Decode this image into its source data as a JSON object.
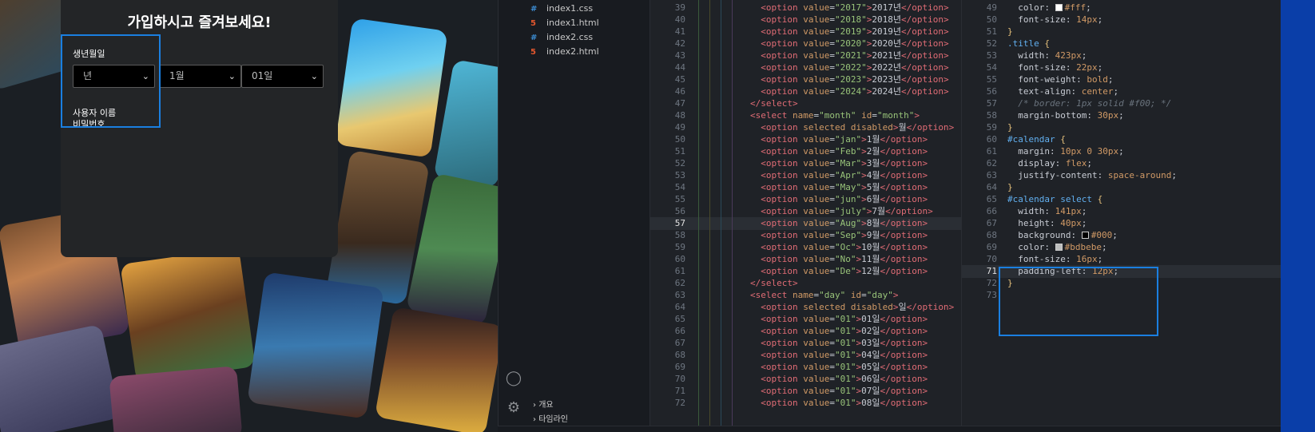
{
  "preview": {
    "title": "가입하시고 즐겨보세요!",
    "birth_label": "생년월일",
    "year_select": "년",
    "month_select": "1월",
    "day_select": "01일",
    "username_label": "사용자 이름",
    "password_label": "비밀번호"
  },
  "explorer": {
    "files": [
      {
        "name": "index1.css",
        "type": "css"
      },
      {
        "name": "index1.html",
        "type": "html"
      },
      {
        "name": "index2.css",
        "type": "css"
      },
      {
        "name": "index2.html",
        "type": "html"
      }
    ],
    "sections": [
      "개요",
      "타임라인"
    ],
    "icons": [
      "account-icon",
      "settings-gear-icon"
    ]
  },
  "html_editor": {
    "lines": [
      {
        "n": "39",
        "t": "  <option value=\"2017\">2017년</option>"
      },
      {
        "n": "40",
        "t": "  <option value=\"2018\">2018년</option>"
      },
      {
        "n": "41",
        "t": "  <option value=\"2019\">2019년</option>"
      },
      {
        "n": "42",
        "t": "  <option value=\"2020\">2020년</option>"
      },
      {
        "n": "43",
        "t": "  <option value=\"2021\">2021년</option>"
      },
      {
        "n": "44",
        "t": "  <option value=\"2022\">2022년</option>"
      },
      {
        "n": "45",
        "t": "  <option value=\"2023\">2023년</option>"
      },
      {
        "n": "46",
        "t": "  <option value=\"2024\">2024년</option>"
      },
      {
        "n": "47",
        "t": "</select>"
      },
      {
        "n": "48",
        "t": "<select name=\"month\" id=\"month\">"
      },
      {
        "n": "49",
        "t": "  <option selected disabled>월</option>"
      },
      {
        "n": "50",
        "t": "  <option value=\"jan\">1월</option>"
      },
      {
        "n": "51",
        "t": "  <option value=\"Feb\">2월</option>"
      },
      {
        "n": "52",
        "t": "  <option value=\"Mar\">3월</option>"
      },
      {
        "n": "53",
        "t": "  <option value=\"Apr\">4월</option>"
      },
      {
        "n": "54",
        "t": "  <option value=\"May\">5월</option>"
      },
      {
        "n": "55",
        "t": "  <option value=\"jun\">6월</option>"
      },
      {
        "n": "56",
        "t": "  <option value=\"july\">7월</option>"
      },
      {
        "n": "57",
        "t": "  <option value=\"Aug\">8월</option>"
      },
      {
        "n": "58",
        "t": "  <option value=\"Sep\">9월</option>"
      },
      {
        "n": "59",
        "t": "  <option value=\"Oc\">10월</option>"
      },
      {
        "n": "60",
        "t": "  <option value=\"No\">11월</option>"
      },
      {
        "n": "61",
        "t": "  <option value=\"De\">12월</option>"
      },
      {
        "n": "62",
        "t": "</select>"
      },
      {
        "n": "63",
        "t": "<select name=\"day\" id=\"day\">"
      },
      {
        "n": "64",
        "t": "  <option selected disabled>일</option>"
      },
      {
        "n": "65",
        "t": "  <option value=\"01\">01일</option>"
      },
      {
        "n": "66",
        "t": "  <option value=\"01\">02일</option>"
      },
      {
        "n": "67",
        "t": "  <option value=\"01\">03일</option>"
      },
      {
        "n": "68",
        "t": "  <option value=\"01\">04일</option>"
      },
      {
        "n": "69",
        "t": "  <option value=\"01\">05일</option>"
      },
      {
        "n": "70",
        "t": "  <option value=\"01\">06일</option>"
      },
      {
        "n": "71",
        "t": "  <option value=\"01\">07일</option>"
      },
      {
        "n": "72",
        "t": "  <option value=\"01\">08일</option>"
      }
    ],
    "active_line": "57"
  },
  "css_editor": {
    "lines": [
      {
        "n": "49",
        "t": "  color: #fff;",
        "swatch": "#ffffff"
      },
      {
        "n": "50",
        "t": "  font-size: 14px;"
      },
      {
        "n": "51",
        "t": "}"
      },
      {
        "n": "52",
        "t": ".title {"
      },
      {
        "n": "53",
        "t": "  width: 423px;"
      },
      {
        "n": "54",
        "t": "  font-size: 22px;"
      },
      {
        "n": "55",
        "t": "  font-weight: bold;"
      },
      {
        "n": "56",
        "t": "  text-align: center;"
      },
      {
        "n": "57",
        "t": "  /* border: 1px solid #f00; */"
      },
      {
        "n": "58",
        "t": "  margin-bottom: 30px;"
      },
      {
        "n": "59",
        "t": "}"
      },
      {
        "n": "60",
        "t": "#calendar {"
      },
      {
        "n": "61",
        "t": "  margin: 10px 0 30px;"
      },
      {
        "n": "62",
        "t": "  display: flex;"
      },
      {
        "n": "63",
        "t": "  justify-content: space-around;"
      },
      {
        "n": "64",
        "t": "}"
      },
      {
        "n": "65",
        "t": "#calendar select {"
      },
      {
        "n": "66",
        "t": "  width: 141px;"
      },
      {
        "n": "67",
        "t": "  height: 40px;"
      },
      {
        "n": "68",
        "t": "  background: #000;",
        "swatch": "#000000"
      },
      {
        "n": "69",
        "t": "  color: #bdbebe;",
        "swatch": "#bdbebe"
      },
      {
        "n": "70",
        "t": "  font-size: 16px;"
      },
      {
        "n": "71",
        "t": "  padding-left: 12px;"
      },
      {
        "n": "72",
        "t": "}"
      },
      {
        "n": "73",
        "t": ""
      }
    ],
    "active_line": "71"
  },
  "colors": {
    "highlight_box": "#1a7fe0",
    "editor_bg": "#1f2227",
    "tag": "#e06c75",
    "attr": "#d19a66",
    "string": "#98c379",
    "selector": "#61afef"
  }
}
